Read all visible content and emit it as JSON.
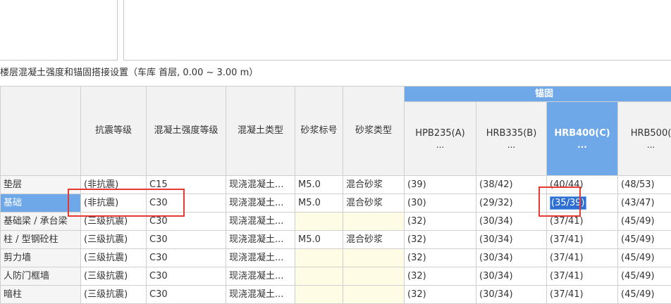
{
  "section_title": "楼层混凝土强度和锚固搭接设置（车库  首层, 0.00 ~ 3.00 m）",
  "table": {
    "group_header": "锚固",
    "columns": [
      "抗震等级",
      "混凝土强度等级",
      "混凝土类型",
      "砂浆标号",
      "砂浆类型"
    ],
    "anchor_columns": [
      "HPB235(A)",
      "HRB335(B)",
      "HRB400(C)",
      "HRB500("
    ],
    "ellipsis": "...",
    "selected_anchor_column": 2,
    "rows": [
      {
        "name": "垫层",
        "cells": [
          "(非抗震)",
          "C15",
          "现浇混凝土...",
          "M5.0",
          "混合砂浆",
          "(39)",
          "(38/42)",
          "(40/44)",
          "(48/53)"
        ]
      },
      {
        "name": "基础",
        "cells": [
          "(非抗震)",
          "C30",
          "现浇混凝土...",
          "M5.0",
          "混合砂浆",
          "(30)",
          "(29/32)",
          "(35/39)",
          "(43/47)"
        ],
        "selected": true
      },
      {
        "name": "基础梁 / 承台梁",
        "cells": [
          "(三级抗震)",
          "C30",
          "现浇混凝土...",
          "",
          "",
          "(32)",
          "(30/34)",
          "(37/41)",
          "(45/49)"
        ]
      },
      {
        "name": "柱 / 型钢砼柱",
        "cells": [
          "(三级抗震)",
          "C30",
          "现浇混凝土...",
          "M5.0",
          "混合砂浆",
          "(32)",
          "(30/34)",
          "(37/41)",
          "(45/49)"
        ]
      },
      {
        "name": "剪力墙",
        "cells": [
          "(三级抗震)",
          "C30",
          "现浇混凝土...",
          "",
          "",
          "(32)",
          "(30/34)",
          "(37/41)",
          "(45/49)"
        ]
      },
      {
        "name": "人防门框墙",
        "cells": [
          "(三级抗震)",
          "C30",
          "现浇混凝土...",
          "",
          "",
          "(32)",
          "(30/34)",
          "(37/41)",
          "(45/49)"
        ]
      },
      {
        "name": "暗柱",
        "cells": [
          "(三级抗震)",
          "C30",
          "现浇混凝土...",
          "",
          "",
          "(32)",
          "(30/34)",
          "(37/41)",
          "(45/49)"
        ]
      }
    ]
  },
  "colors": {
    "header_selected": "#6fa8e8",
    "highlight": "#e43a32",
    "empty_cell": "#fffce6"
  }
}
